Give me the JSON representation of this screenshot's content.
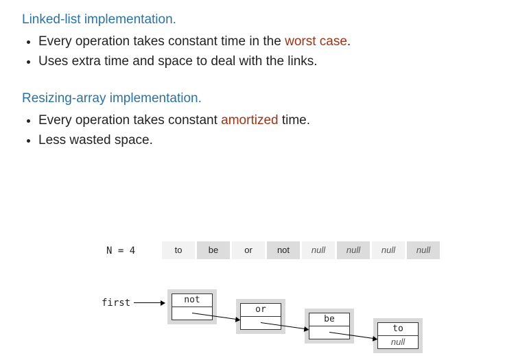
{
  "section1": {
    "heading": "Linked-list implementation.",
    "bullet1_pre": "Every operation takes constant time in the ",
    "bullet1_em": "worst case",
    "bullet1_post": ".",
    "bullet2": "Uses extra time and space to deal with the links."
  },
  "section2": {
    "heading": "Resizing-array implementation.",
    "bullet1_pre": "Every operation takes constant ",
    "bullet1_em": "amortized",
    "bullet1_post": " time.",
    "bullet2": "Less wasted space."
  },
  "diagram": {
    "n_label": "N = 4",
    "first_label": "first",
    "array": [
      "to",
      "be",
      "or",
      "not",
      "null",
      "null",
      "null",
      "null"
    ],
    "array_null_start": 4,
    "nodes": [
      {
        "value": "not",
        "next": ""
      },
      {
        "value": "or",
        "next": ""
      },
      {
        "value": "be",
        "next": ""
      },
      {
        "value": "to",
        "next": "null"
      }
    ]
  }
}
